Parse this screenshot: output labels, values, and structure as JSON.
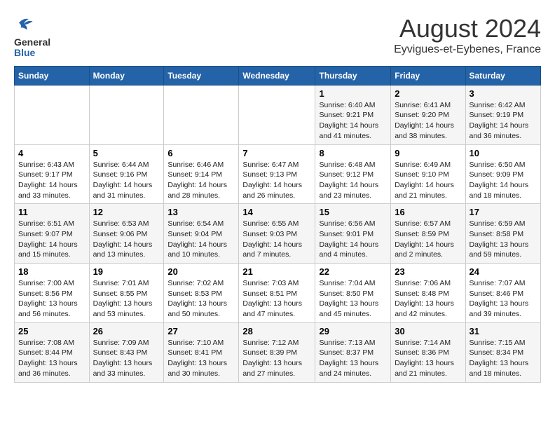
{
  "header": {
    "logo_line1": "General",
    "logo_line2": "Blue",
    "main_title": "August 2024",
    "subtitle": "Eyvigues-et-Eybenes, France"
  },
  "days_of_week": [
    "Sunday",
    "Monday",
    "Tuesday",
    "Wednesday",
    "Thursday",
    "Friday",
    "Saturday"
  ],
  "weeks": [
    [
      {
        "day": "",
        "info": ""
      },
      {
        "day": "",
        "info": ""
      },
      {
        "day": "",
        "info": ""
      },
      {
        "day": "",
        "info": ""
      },
      {
        "day": "1",
        "info": "Sunrise: 6:40 AM\nSunset: 9:21 PM\nDaylight: 14 hours\nand 41 minutes."
      },
      {
        "day": "2",
        "info": "Sunrise: 6:41 AM\nSunset: 9:20 PM\nDaylight: 14 hours\nand 38 minutes."
      },
      {
        "day": "3",
        "info": "Sunrise: 6:42 AM\nSunset: 9:19 PM\nDaylight: 14 hours\nand 36 minutes."
      }
    ],
    [
      {
        "day": "4",
        "info": "Sunrise: 6:43 AM\nSunset: 9:17 PM\nDaylight: 14 hours\nand 33 minutes."
      },
      {
        "day": "5",
        "info": "Sunrise: 6:44 AM\nSunset: 9:16 PM\nDaylight: 14 hours\nand 31 minutes."
      },
      {
        "day": "6",
        "info": "Sunrise: 6:46 AM\nSunset: 9:14 PM\nDaylight: 14 hours\nand 28 minutes."
      },
      {
        "day": "7",
        "info": "Sunrise: 6:47 AM\nSunset: 9:13 PM\nDaylight: 14 hours\nand 26 minutes."
      },
      {
        "day": "8",
        "info": "Sunrise: 6:48 AM\nSunset: 9:12 PM\nDaylight: 14 hours\nand 23 minutes."
      },
      {
        "day": "9",
        "info": "Sunrise: 6:49 AM\nSunset: 9:10 PM\nDaylight: 14 hours\nand 21 minutes."
      },
      {
        "day": "10",
        "info": "Sunrise: 6:50 AM\nSunset: 9:09 PM\nDaylight: 14 hours\nand 18 minutes."
      }
    ],
    [
      {
        "day": "11",
        "info": "Sunrise: 6:51 AM\nSunset: 9:07 PM\nDaylight: 14 hours\nand 15 minutes."
      },
      {
        "day": "12",
        "info": "Sunrise: 6:53 AM\nSunset: 9:06 PM\nDaylight: 14 hours\nand 13 minutes."
      },
      {
        "day": "13",
        "info": "Sunrise: 6:54 AM\nSunset: 9:04 PM\nDaylight: 14 hours\nand 10 minutes."
      },
      {
        "day": "14",
        "info": "Sunrise: 6:55 AM\nSunset: 9:03 PM\nDaylight: 14 hours\nand 7 minutes."
      },
      {
        "day": "15",
        "info": "Sunrise: 6:56 AM\nSunset: 9:01 PM\nDaylight: 14 hours\nand 4 minutes."
      },
      {
        "day": "16",
        "info": "Sunrise: 6:57 AM\nSunset: 8:59 PM\nDaylight: 14 hours\nand 2 minutes."
      },
      {
        "day": "17",
        "info": "Sunrise: 6:59 AM\nSunset: 8:58 PM\nDaylight: 13 hours\nand 59 minutes."
      }
    ],
    [
      {
        "day": "18",
        "info": "Sunrise: 7:00 AM\nSunset: 8:56 PM\nDaylight: 13 hours\nand 56 minutes."
      },
      {
        "day": "19",
        "info": "Sunrise: 7:01 AM\nSunset: 8:55 PM\nDaylight: 13 hours\nand 53 minutes."
      },
      {
        "day": "20",
        "info": "Sunrise: 7:02 AM\nSunset: 8:53 PM\nDaylight: 13 hours\nand 50 minutes."
      },
      {
        "day": "21",
        "info": "Sunrise: 7:03 AM\nSunset: 8:51 PM\nDaylight: 13 hours\nand 47 minutes."
      },
      {
        "day": "22",
        "info": "Sunrise: 7:04 AM\nSunset: 8:50 PM\nDaylight: 13 hours\nand 45 minutes."
      },
      {
        "day": "23",
        "info": "Sunrise: 7:06 AM\nSunset: 8:48 PM\nDaylight: 13 hours\nand 42 minutes."
      },
      {
        "day": "24",
        "info": "Sunrise: 7:07 AM\nSunset: 8:46 PM\nDaylight: 13 hours\nand 39 minutes."
      }
    ],
    [
      {
        "day": "25",
        "info": "Sunrise: 7:08 AM\nSunset: 8:44 PM\nDaylight: 13 hours\nand 36 minutes."
      },
      {
        "day": "26",
        "info": "Sunrise: 7:09 AM\nSunset: 8:43 PM\nDaylight: 13 hours\nand 33 minutes."
      },
      {
        "day": "27",
        "info": "Sunrise: 7:10 AM\nSunset: 8:41 PM\nDaylight: 13 hours\nand 30 minutes."
      },
      {
        "day": "28",
        "info": "Sunrise: 7:12 AM\nSunset: 8:39 PM\nDaylight: 13 hours\nand 27 minutes."
      },
      {
        "day": "29",
        "info": "Sunrise: 7:13 AM\nSunset: 8:37 PM\nDaylight: 13 hours\nand 24 minutes."
      },
      {
        "day": "30",
        "info": "Sunrise: 7:14 AM\nSunset: 8:36 PM\nDaylight: 13 hours\nand 21 minutes."
      },
      {
        "day": "31",
        "info": "Sunrise: 7:15 AM\nSunset: 8:34 PM\nDaylight: 13 hours\nand 18 minutes."
      }
    ]
  ]
}
